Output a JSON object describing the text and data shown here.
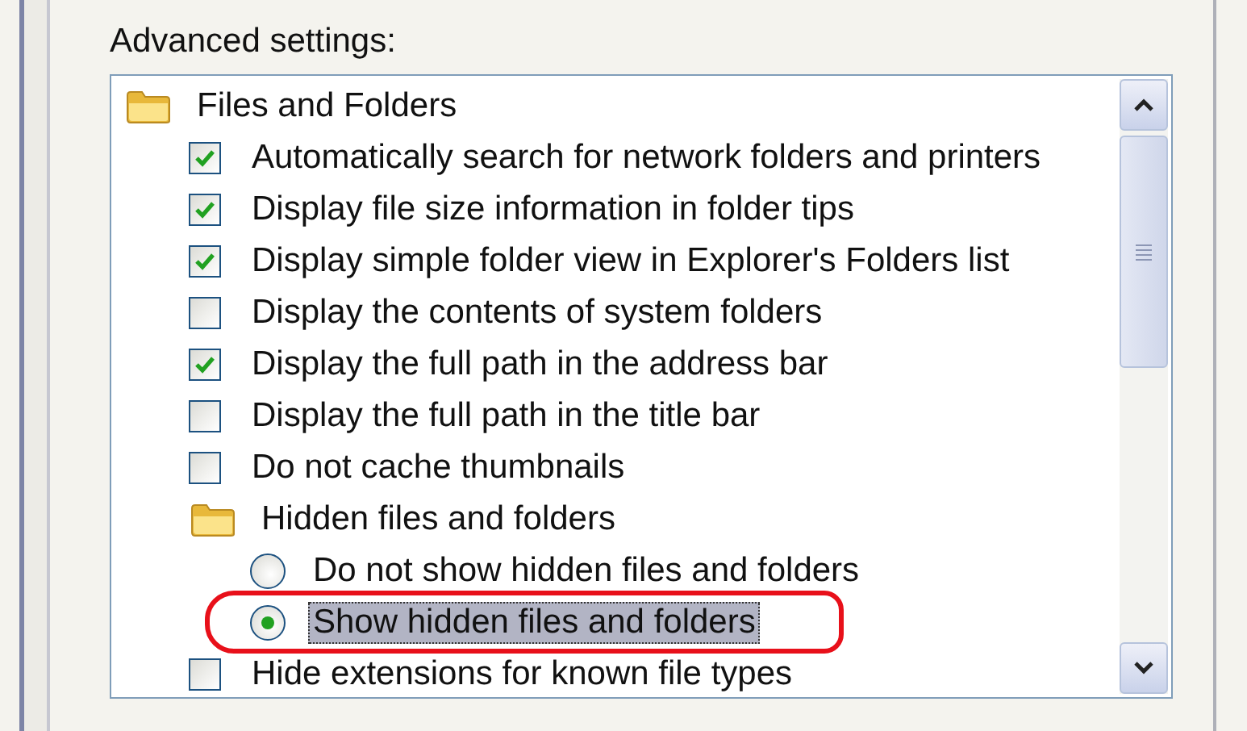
{
  "label": "Advanced settings:",
  "settings": [
    {
      "kind": "group",
      "label": "Files and Folders",
      "children": [
        {
          "kind": "checkbox",
          "label": "Automatically search for network folders and printers",
          "checked": true
        },
        {
          "kind": "checkbox",
          "label": "Display file size information in folder tips",
          "checked": true
        },
        {
          "kind": "checkbox",
          "label": "Display simple folder view in Explorer's Folders list",
          "checked": true
        },
        {
          "kind": "checkbox",
          "label": "Display the contents of system folders",
          "checked": false
        },
        {
          "kind": "checkbox",
          "label": "Display the full path in the address bar",
          "checked": true
        },
        {
          "kind": "checkbox",
          "label": "Display the full path in the title bar",
          "checked": false
        },
        {
          "kind": "checkbox",
          "label": "Do not cache thumbnails",
          "checked": false
        },
        {
          "kind": "group",
          "label": "Hidden files and folders",
          "children": [
            {
              "kind": "radio",
              "label": "Do not show hidden files and folders",
              "selected": false,
              "focused": false,
              "circled": false
            },
            {
              "kind": "radio",
              "label": "Show hidden files and folders",
              "selected": true,
              "focused": true,
              "circled": true
            }
          ]
        },
        {
          "kind": "checkbox",
          "label": "Hide extensions for known file types",
          "checked": false
        }
      ]
    }
  ]
}
